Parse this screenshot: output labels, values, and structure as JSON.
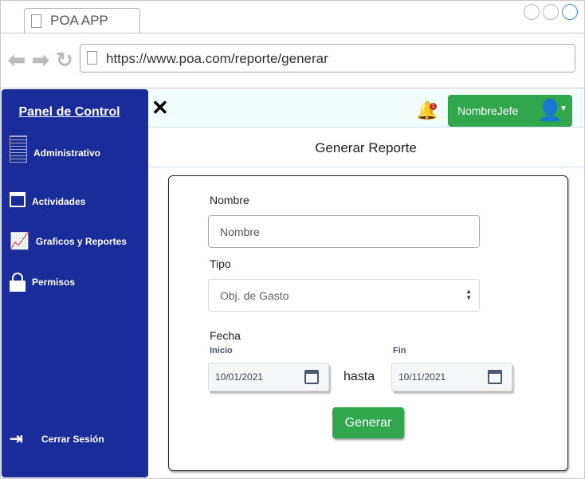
{
  "browser": {
    "tab_title": "POA APP",
    "url": "https://www.poa.com/reporte/generar"
  },
  "sidebar": {
    "title": "Panel de Control",
    "items": [
      {
        "label": "Administrativo",
        "icon": "building-icon"
      },
      {
        "label": "Actividades",
        "icon": "calendar-icon"
      },
      {
        "label": "Graficos y Reportes",
        "icon": "chart-icon"
      },
      {
        "label": "Permisos",
        "icon": "lock-icon"
      }
    ],
    "logout": "Cerrar Sesión"
  },
  "topbar": {
    "notifications": "1",
    "user": "NombreJefe"
  },
  "page": {
    "title": "Generar Reporte"
  },
  "form": {
    "nombre_label": "Nombre",
    "nombre_placeholder": "Nombre",
    "tipo_label": "Tipo",
    "tipo_value": "Obj. de Gasto",
    "fecha_label": "Fecha",
    "inicio_label": "Inicio",
    "inicio_value": "10/01/2021",
    "hasta": "hasta",
    "fin_label": "Fin",
    "fin_value": "10/11/2021",
    "submit": "Generar"
  }
}
